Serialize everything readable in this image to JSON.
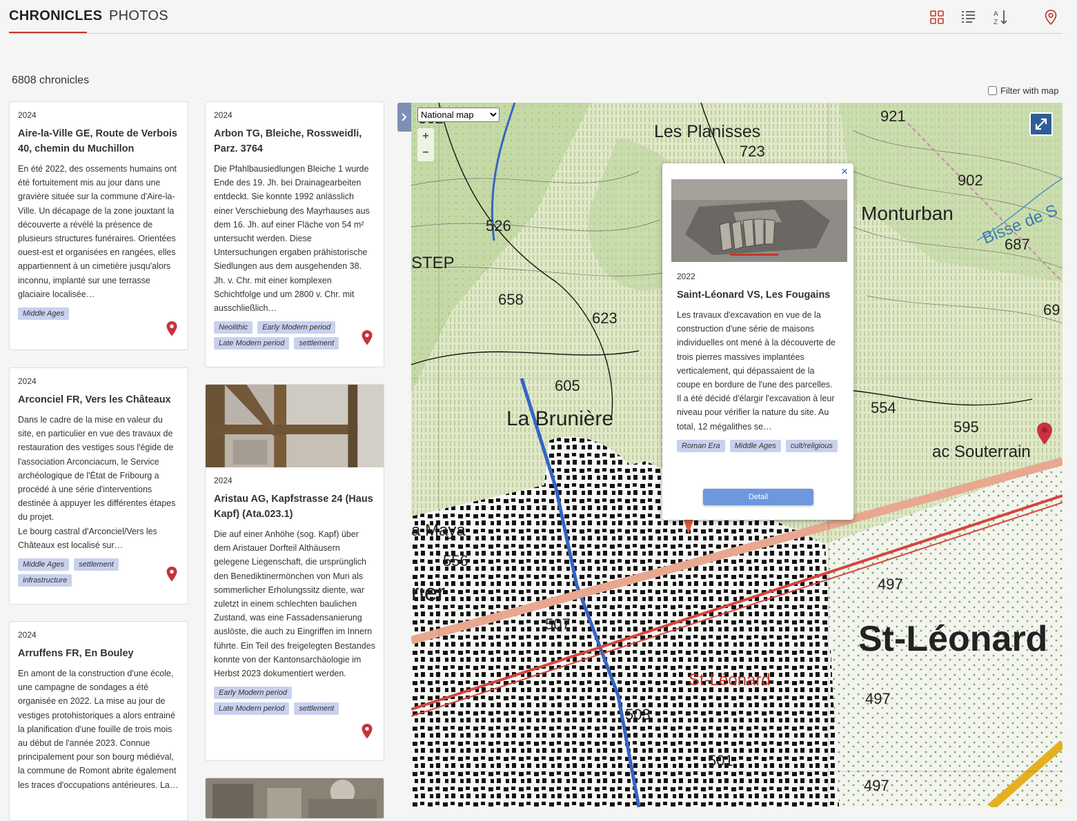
{
  "nav": {
    "tabs": [
      {
        "label": "CHRONICLES",
        "active": true
      },
      {
        "label": "PHOTOS",
        "active": false
      }
    ],
    "icons": [
      "grid-view-icon",
      "list-view-icon",
      "sort-az-icon",
      "map-pin-icon"
    ]
  },
  "count_label": "6808 chronicles",
  "filter": {
    "label": "Filter with map",
    "checked": false
  },
  "cards": [
    {
      "year": "2024",
      "title": "Aire-la-Ville GE, Route de Verbois 40, chemin du Muchillon",
      "text": "En été 2022, des ossements humains ont été fortuitement mis au jour dans une gravière située sur la commune d'Aire-la-Ville. Un décapage de la zone jouxtant la découverte a révélé la présence de plusieurs structures funéraires. Orientées ouest-est et organisées en rangées, elles appartiennent à un cimetière jusqu'alors inconnu, implanté sur une terrasse glaciaire localisée…",
      "tags": [
        "Middle Ages"
      ]
    },
    {
      "year": "2024",
      "title": "Arconciel FR, Vers les Châteaux",
      "text": "Dans le cadre de la mise en valeur du site, en particulier en vue des travaux de restauration des vestiges sous l'égide de l'association Arconciacum, le Service archéologique de l'État de Fribourg a procédé à une série d'interventions destinée à appuyer les différentes étapes du projet.\nLe bourg castral d'Arconciel/Vers les Châteaux est localisé sur…",
      "tags": [
        "Middle Ages",
        "settlement",
        "infrastructure"
      ]
    },
    {
      "year": "2024",
      "title": "Arruffens FR, En Bouley",
      "text": "En amont de la construction d'une école, une campagne de sondages a été organisée en 2022. La mise au jour de vestiges protohistoriques a alors entrainé la planification d'une fouille de trois mois au début de l'année 2023. Connue principalement pour son bourg médiéval, la commune de Romont abrite également les traces d'occupations antérieures. La…",
      "tags": []
    },
    {
      "year": "2024",
      "title": "Arbon TG, Bleiche, Rossweidli, Parz. 3764",
      "text": "Die Pfahlbausiedlungen Bleiche 1 wurde Ende des 19. Jh. bei Drainagearbeiten entdeckt. Sie konnte 1992 anlässlich einer Verschiebung des Mayrhauses aus dem 16. Jh. auf einer Fläche von 54 m² untersucht werden. Diese Untersuchungen ergaben prähistorische Siedlungen aus dem ausgehenden 38. Jh. v. Chr. mit einer komplexen Schichtfolge und um 2800 v. Chr. mit ausschließlich…",
      "tags": [
        "Neolithic",
        "Early Modern period",
        "Late Modern period",
        "settlement"
      ]
    },
    {
      "year": "2024",
      "title": "Aristau AG, Kapfstrasse 24 (Haus Kapf) (Ata.023.1)",
      "text": "Die auf einer Anhöhe (sog. Kapf) über dem Aristauer Dorfteil Althäusern gelegene Liegenschaft, die ursprünglich den Benediktinermönchen von Muri als sommerlicher Erholungssitz diente, war zuletzt in einem schlechten baulichen Zustand, was eine Fassadensanierung auslöste, die auch zu Eingriffen im Innern führte. Ein Teil des freigelegten Bestandes konnte von der Kantonsarchäologie im Herbst 2023 dokumentiert werden.",
      "tags": [
        "Early Modern period",
        "Late Modern period",
        "settlement"
      ]
    }
  ],
  "map": {
    "layer_select": "National map",
    "zoom_in": "+",
    "zoom_out": "−",
    "labels": {
      "planisses": "Les Planisses",
      "brun": "La Brunière",
      "monturban": "Monturban",
      "souterrain": "ac Souterrain",
      "maya": "a Maya",
      "stleo": "St-Léonard",
      "stleo_small": "St-Léonard",
      "bisse": "Bisse de S",
      "step": "STEP",
      "rier": "rier"
    },
    "elevations": [
      "921",
      "723",
      "902",
      "526",
      "687",
      "658",
      "623",
      "69",
      "605",
      "554",
      "595",
      "556",
      "497",
      "507",
      "497",
      "503",
      "501",
      "497",
      "362"
    ]
  },
  "popup": {
    "year": "2022",
    "title": "Saint-Léonard VS, Les Fougains",
    "text": "Les travaux d'excavation en vue de la construction d'une série de maisons individuelles ont mené à la découverte de trois pierres massives implantées verticalement, qui dépassaient de la coupe en bordure de l'une des parcelles. Il a été décidé d'élargir l'excavation à leur niveau pour vérifier la nature du site. Au total, 12 mégalithes se…",
    "tags": [
      "Roman Era",
      "Middle Ages",
      "cult/religious"
    ],
    "detail_label": "Detail",
    "close": "×"
  },
  "colors": {
    "accent": "#c0392b",
    "tag_bg": "#c9d1ee",
    "button": "#6f97dd",
    "toggle": "#7e8fb6"
  }
}
